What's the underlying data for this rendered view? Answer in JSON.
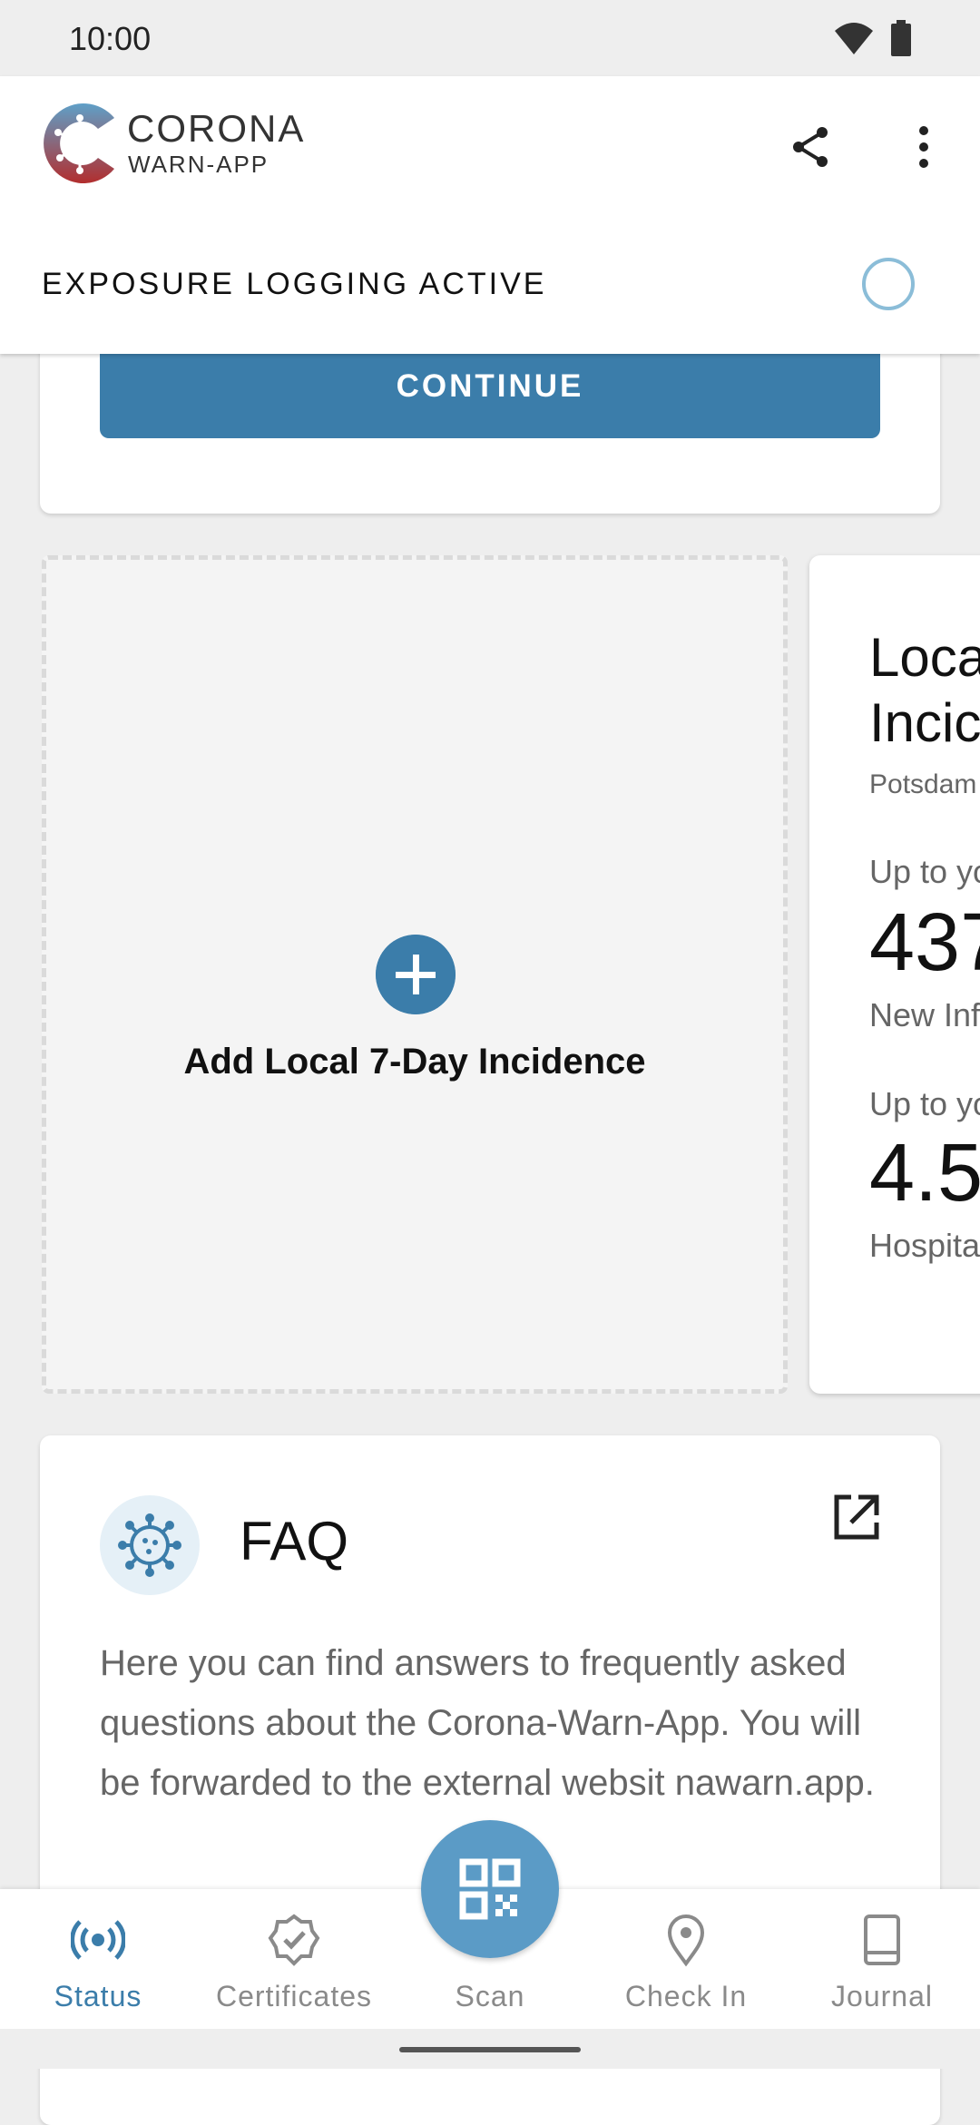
{
  "status_bar": {
    "time": "10:00"
  },
  "header": {
    "logo_line1": "CORONA",
    "logo_line2": "WARN-APP",
    "exposure_status": "EXPOSURE LOGGING ACTIVE"
  },
  "top_card": {
    "continue_label": "CONTINUE"
  },
  "incidence": {
    "add_label": "Add Local 7-Day Incidence",
    "card_title_1": "Loca",
    "card_title_2": "Incic",
    "district": "Potsdam",
    "row1_caption": "Up to yo",
    "row1_value": "437",
    "row1_label": "New Inf",
    "row2_caption": "Up to yo",
    "row2_value": "4.5",
    "row2_label": "Hospita"
  },
  "faq": {
    "title": "FAQ",
    "body": "Here you can find answers to frequently asked questions about the Corona-Warn-App. You will be forwarded to the external websit      nawarn.app."
  },
  "bottom_nav": {
    "items": [
      {
        "label": "Status",
        "icon": "broadcast-icon",
        "active": true
      },
      {
        "label": "Certificates",
        "icon": "certificate-badge-icon",
        "active": false
      },
      {
        "label": "Scan",
        "icon": "qr-code-icon",
        "active": false
      },
      {
        "label": "Check In",
        "icon": "location-pin-icon",
        "active": false
      },
      {
        "label": "Journal",
        "icon": "book-icon",
        "active": false
      }
    ]
  },
  "colors": {
    "accent": "#3b7daa",
    "fab": "#5b9bc6",
    "ring": "#8bbdd8",
    "logo_red": "#b22e2e"
  }
}
